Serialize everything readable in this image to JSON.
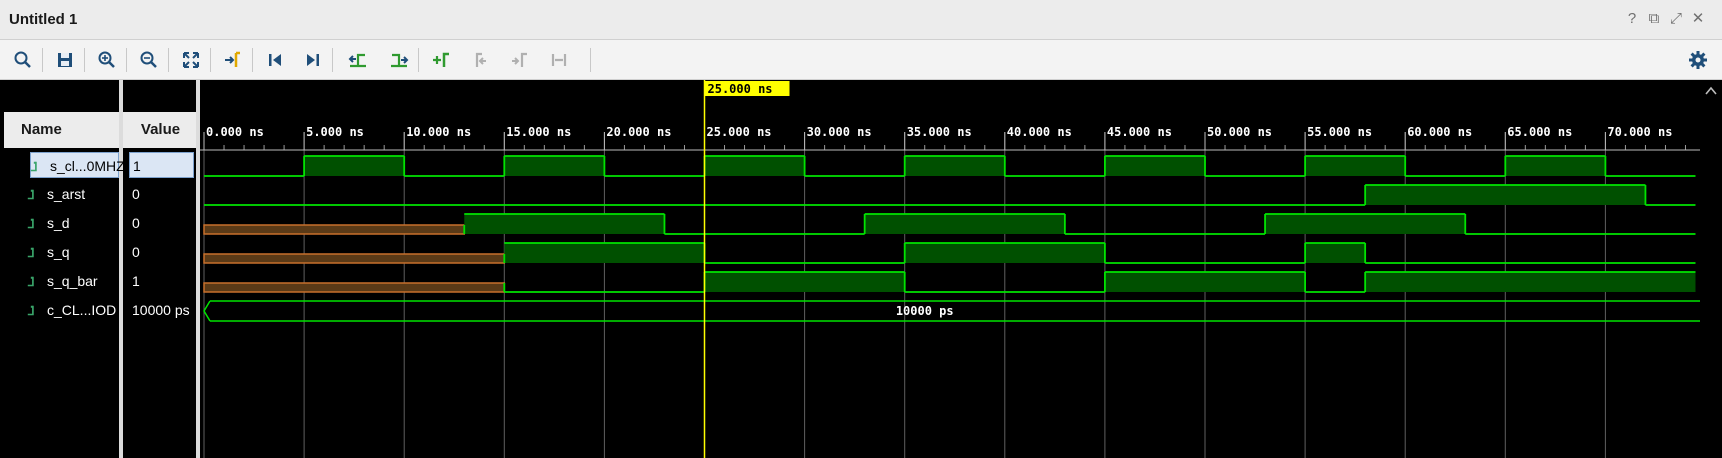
{
  "window": {
    "title": "Untitled 1",
    "controls": [
      "help-icon",
      "restore-icon",
      "maximize-icon",
      "close-icon"
    ]
  },
  "toolbar": {
    "items": [
      "search-icon",
      "save-icon",
      "zoom-in-icon",
      "zoom-out-icon",
      "zoom-fit-icon",
      "go-to-cursor-icon",
      "go-to-time-0-icon",
      "go-to-last-time-icon",
      "previous-transition-icon",
      "next-transition-icon",
      "add-marker-icon",
      "previous-marker-icon",
      "next-marker-icon",
      "swap-cursors-icon",
      "settings-icon"
    ]
  },
  "columns": {
    "name": "Name",
    "value": "Value"
  },
  "cursor": {
    "label": "25.000 ns",
    "time_ns": 25
  },
  "timeline": {
    "ticks": [
      "0.000 ns",
      "5.000 ns",
      "10.000 ns",
      "15.000 ns",
      "20.000 ns",
      "25.000 ns",
      "30.000 ns",
      "35.000 ns",
      "40.000 ns",
      "45.000 ns",
      "50.000 ns",
      "55.000 ns",
      "60.000 ns",
      "65.000 ns",
      "70.000 ns"
    ],
    "start_ns": 0,
    "end_ns": 74.5
  },
  "signals": [
    {
      "name": "s_cl...0MHZ",
      "value": "1",
      "selected": true,
      "kind": "bit",
      "segments": [
        [
          0,
          5,
          "0"
        ],
        [
          5,
          10,
          "1"
        ],
        [
          10,
          15,
          "0"
        ],
        [
          15,
          20,
          "1"
        ],
        [
          20,
          25,
          "0"
        ],
        [
          25,
          30,
          "1"
        ],
        [
          30,
          35,
          "0"
        ],
        [
          35,
          40,
          "1"
        ],
        [
          40,
          45,
          "0"
        ],
        [
          45,
          50,
          "1"
        ],
        [
          50,
          55,
          "0"
        ],
        [
          55,
          60,
          "1"
        ],
        [
          60,
          65,
          "0"
        ],
        [
          65,
          70,
          "1"
        ],
        [
          70,
          74.5,
          "0"
        ]
      ]
    },
    {
      "name": "s_arst",
      "value": "0",
      "selected": false,
      "kind": "bit",
      "segments": [
        [
          0,
          58,
          "0"
        ],
        [
          58,
          72,
          "1"
        ],
        [
          72,
          74.5,
          "0"
        ]
      ]
    },
    {
      "name": "s_d",
      "value": "0",
      "selected": false,
      "kind": "bit",
      "segments": [
        [
          0,
          13,
          "U"
        ],
        [
          13,
          23,
          "1"
        ],
        [
          23,
          33,
          "0"
        ],
        [
          33,
          43,
          "1"
        ],
        [
          43,
          53,
          "0"
        ],
        [
          53,
          63,
          "1"
        ],
        [
          63,
          74.5,
          "0"
        ]
      ]
    },
    {
      "name": "s_q",
      "value": "0",
      "selected": false,
      "kind": "bit",
      "segments": [
        [
          0,
          15,
          "U"
        ],
        [
          15,
          25,
          "1"
        ],
        [
          25,
          35,
          "0"
        ],
        [
          35,
          45,
          "1"
        ],
        [
          45,
          55,
          "0"
        ],
        [
          55,
          58,
          "1"
        ],
        [
          58,
          74.5,
          "0"
        ]
      ]
    },
    {
      "name": "s_q_bar",
      "value": "1",
      "selected": false,
      "kind": "bit",
      "segments": [
        [
          0,
          15,
          "U"
        ],
        [
          15,
          25,
          "0"
        ],
        [
          25,
          35,
          "1"
        ],
        [
          35,
          45,
          "0"
        ],
        [
          45,
          55,
          "1"
        ],
        [
          55,
          58,
          "0"
        ],
        [
          58,
          74.5,
          "1"
        ]
      ]
    },
    {
      "name": "c_CL...IOD",
      "value": "10000 ps",
      "selected": false,
      "kind": "bus",
      "bus_label": "10000 ps"
    }
  ],
  "colors": {
    "background": "#000000",
    "wave": "#00e400",
    "wave_fill": "#005000",
    "undefined": "#c8702c",
    "undefined_fill": "#5a3a17",
    "grid": "#606060",
    "cursor": "#ffff00"
  }
}
